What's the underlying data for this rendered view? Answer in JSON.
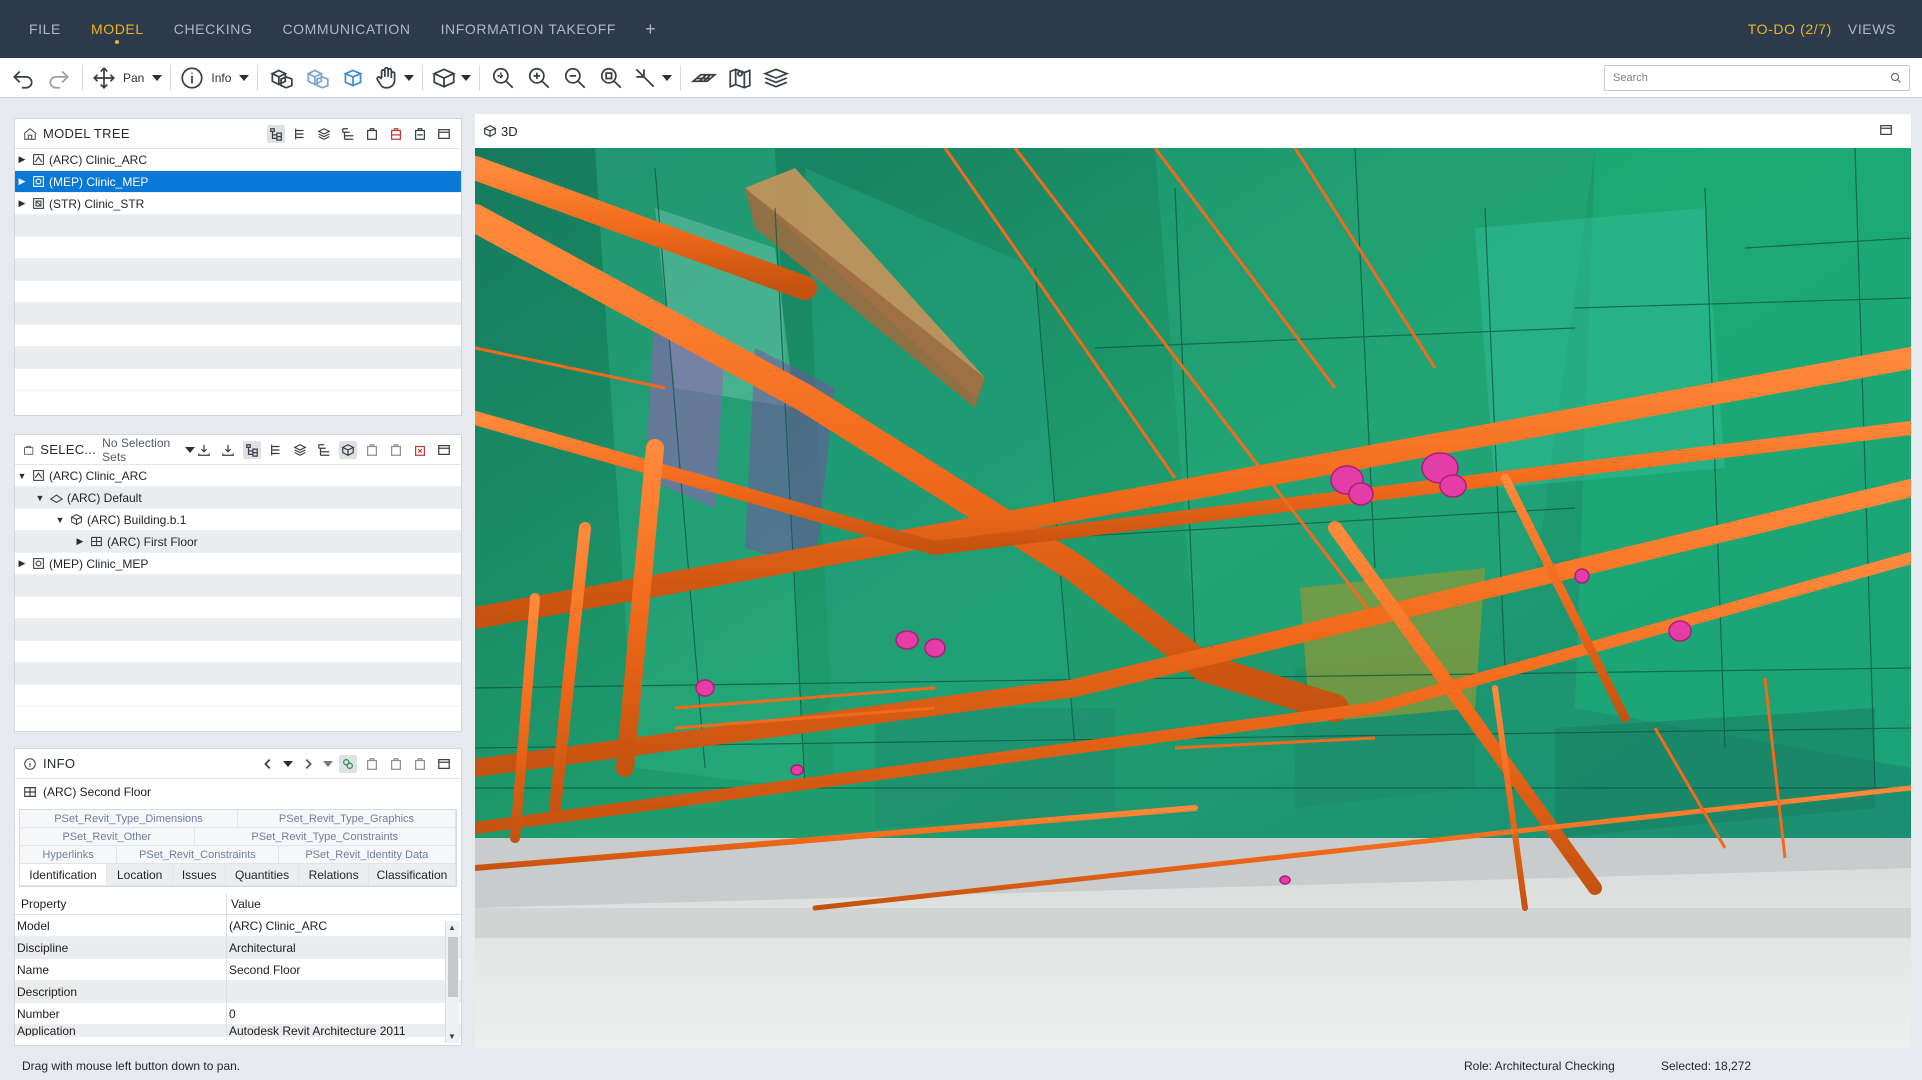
{
  "menu": {
    "tabs": [
      "FILE",
      "MODEL",
      "CHECKING",
      "COMMUNICATION",
      "INFORMATION TAKEOFF"
    ],
    "active_tab": "MODEL",
    "plus": "+",
    "todo": "TO-DO (2/7)",
    "views": "VIEWS"
  },
  "toolbar": {
    "pan_label": "Pan",
    "info_label": "Info",
    "search_placeholder": "Search"
  },
  "model_tree": {
    "title": "MODEL TREE",
    "items": [
      {
        "label": "(ARC) Clinic_ARC",
        "icon": "architecture-model-icon",
        "selected": false
      },
      {
        "label": "(MEP) Clinic_MEP",
        "icon": "mep-model-icon",
        "selected": true
      },
      {
        "label": "(STR) Clinic_STR",
        "icon": "structure-model-icon",
        "selected": false
      }
    ]
  },
  "selection_sets": {
    "title": "SELEC...",
    "dropdown_value": "No Selection Sets",
    "tree": [
      {
        "label": "(ARC) Clinic_ARC",
        "level": 0,
        "expanded": true,
        "icon": "architecture-model-icon"
      },
      {
        "label": "(ARC) Default",
        "level": 1,
        "expanded": true,
        "icon": "site-icon"
      },
      {
        "label": "(ARC) Building.b.1",
        "level": 2,
        "expanded": true,
        "icon": "building-icon"
      },
      {
        "label": "(ARC) First Floor",
        "level": 3,
        "expanded": false,
        "icon": "floor-icon"
      },
      {
        "label": "(MEP) Clinic_MEP",
        "level": 0,
        "expanded": false,
        "icon": "mep-model-icon"
      }
    ]
  },
  "info": {
    "title": "INFO",
    "object": "(ARC) Second Floor",
    "pset_tabs_row1": [
      "PSet_Revit_Type_Dimensions",
      "PSet_Revit_Type_Graphics"
    ],
    "pset_tabs_row2": [
      "PSet_Revit_Other",
      "PSet_Revit_Type_Constraints"
    ],
    "pset_tabs_row3": [
      "Hyperlinks",
      "PSet_Revit_Constraints",
      "PSet_Revit_Identity Data"
    ],
    "main_tabs": [
      "Identification",
      "Location",
      "Issues",
      "Quantities",
      "Relations",
      "Classification"
    ],
    "active_main_tab": "Identification",
    "columns": [
      "Property",
      "Value"
    ],
    "properties": [
      {
        "k": "Model",
        "v": "(ARC) Clinic_ARC"
      },
      {
        "k": "Discipline",
        "v": "Architectural"
      },
      {
        "k": "Name",
        "v": "Second Floor"
      },
      {
        "k": "Description",
        "v": ""
      },
      {
        "k": "Number",
        "v": "0"
      },
      {
        "k": "Application",
        "v": "Autodesk Revit Architecture 2011"
      }
    ]
  },
  "view3d": {
    "title": "3D"
  },
  "status": {
    "hint": "Drag with mouse left button down to pan.",
    "role": "Role: Architectural Checking",
    "selected": "Selected: 18,272"
  },
  "colors": {
    "menubar": "#2d3a4b",
    "accent": "#f0b41e",
    "selection": "#0a78d7",
    "pipe": "#f26a1b",
    "scene_green": "#1e9e6e",
    "valve": "#e63ca8"
  }
}
